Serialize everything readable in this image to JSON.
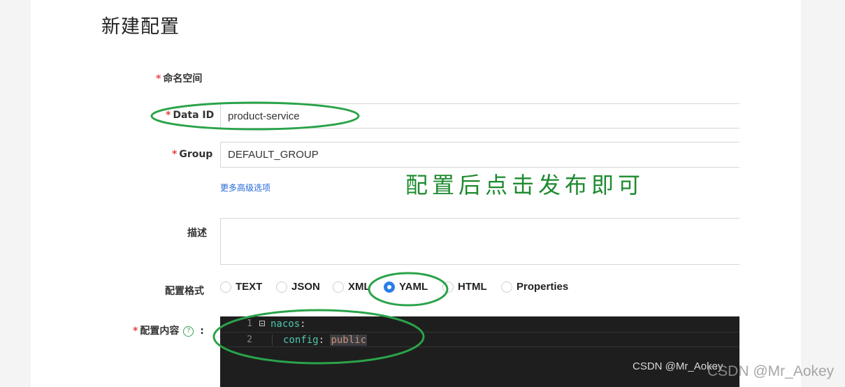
{
  "page": {
    "title": "新建配置"
  },
  "form": {
    "namespace": {
      "label": "命名空间"
    },
    "data_id": {
      "label": "Data ID",
      "value": "product-service"
    },
    "group": {
      "label": "Group",
      "value": "DEFAULT_GROUP"
    },
    "advanced_link": "更多高级选项",
    "description": {
      "label": "描述",
      "value": ""
    },
    "format": {
      "label": "配置格式",
      "options": [
        "TEXT",
        "JSON",
        "XML",
        "YAML",
        "HTML",
        "Properties"
      ],
      "selected": "YAML"
    },
    "content": {
      "label": "配置内容",
      "help_icon": "question-circle-icon",
      "colon": ":",
      "lines": [
        {
          "number": "1",
          "key": "nacos",
          "sep": ":",
          "value": ""
        },
        {
          "number": "2",
          "key": "config",
          "sep": ": ",
          "value": "public"
        }
      ]
    }
  },
  "annotation": {
    "text": "配置后点击发布即可",
    "color": "#1e8a2f"
  },
  "watermarks": {
    "editor": "CSDN @Mr_Aokey",
    "page": "CSDN @Mr_Aokey"
  },
  "colors": {
    "required": "#e54545",
    "link": "#2469d8",
    "radio_selected": "#2b7de9",
    "highlight_ring": "#2aa34a"
  }
}
